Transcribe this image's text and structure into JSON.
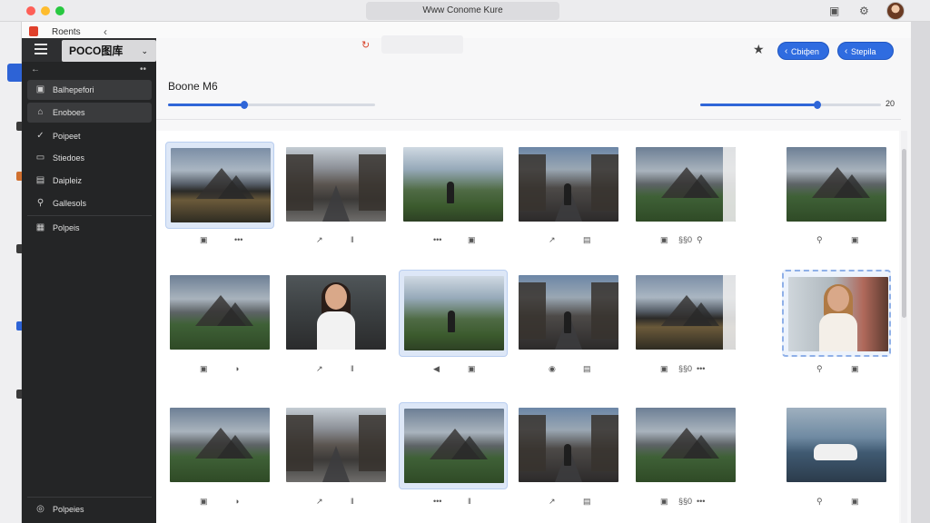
{
  "os": {
    "window_title": "Www Conome Kure",
    "icons": [
      "calendar-icon",
      "gear-icon",
      "user-avatar"
    ]
  },
  "tab": {
    "label": "Roents",
    "close": "‹"
  },
  "sidebar": {
    "app_title": "POCO图库",
    "chevron": "⌄",
    "back": "←",
    "more": "••",
    "items": [
      {
        "label": "Balhepefori",
        "icon": "▣",
        "active": true
      },
      {
        "label": "Enoboes",
        "icon": "⌂",
        "active": true
      },
      {
        "label": "Poipeet",
        "icon": "✓",
        "active": false
      },
      {
        "label": "Stiedoes",
        "icon": "▭",
        "active": false
      },
      {
        "label": "Daipleiz",
        "icon": "▤",
        "active": false
      },
      {
        "label": "Gallesols",
        "icon": "⚲",
        "active": false
      },
      {
        "label": "Polpeis",
        "icon": "▦",
        "active": false
      }
    ],
    "footer": {
      "label": "Polpeies",
      "icon": "◎"
    }
  },
  "toolbar": {
    "logo": "↻",
    "star": "★",
    "btn1": "Сbiфen",
    "btn2": "Stepila"
  },
  "header": {
    "title": "Boone M6",
    "size_slider": 0.37,
    "zoom_slider": 0.65,
    "zoom_value": "20"
  },
  "grid": {
    "rows": [
      [
        {
          "scene": "sc-mtn-dusk",
          "selected": true,
          "actions": [
            "▣",
            "•••"
          ]
        },
        {
          "scene": "sc-street",
          "selected": false,
          "actions": [
            "↗",
            "‖"
          ]
        },
        {
          "scene": "sc-field",
          "selected": false,
          "actions": [
            "•••",
            "▣"
          ]
        },
        {
          "scene": "sc-city",
          "selected": false,
          "actions": [
            "↗",
            "▤"
          ]
        },
        {
          "scene": "sc-mtn-green",
          "selected": false,
          "actions": [
            "▣",
            "§§0",
            "⚲"
          ]
        },
        {
          "scene": "sc-mtn-green",
          "selected": false,
          "actions": [
            "⚲",
            "▣"
          ]
        }
      ],
      [
        {
          "scene": "sc-mtn-green",
          "selected": false,
          "actions": [
            "▣",
            "◑"
          ]
        },
        {
          "scene": "sc-portrait",
          "selected": false,
          "actions": [
            "↗",
            "‖"
          ]
        },
        {
          "scene": "sc-field",
          "selected": true,
          "actions": [
            "◀",
            "▣"
          ]
        },
        {
          "scene": "sc-city",
          "selected": false,
          "actions": [
            "◉",
            "▤"
          ]
        },
        {
          "scene": "sc-mtn-dusk",
          "selected": false,
          "actions": [
            "▣",
            "§§0",
            "•••"
          ]
        },
        {
          "scene": "sc-interior",
          "selected": "dash",
          "actions": [
            "⚲",
            "▣"
          ]
        }
      ],
      [
        {
          "scene": "sc-mtn-green",
          "selected": false,
          "actions": [
            "▣",
            "◑"
          ]
        },
        {
          "scene": "sc-street",
          "selected": false,
          "actions": [
            "↗",
            "‖"
          ]
        },
        {
          "scene": "sc-mtn-green",
          "selected": true,
          "actions": [
            "•••",
            "‖"
          ]
        },
        {
          "scene": "sc-city",
          "selected": false,
          "actions": [
            "↗",
            "▤"
          ]
        },
        {
          "scene": "sc-mtn-green",
          "selected": false,
          "actions": [
            "▣",
            "§§0",
            "•••"
          ]
        },
        {
          "scene": "sc-lake",
          "selected": false,
          "actions": [
            "⚲",
            "▣"
          ]
        }
      ]
    ]
  }
}
